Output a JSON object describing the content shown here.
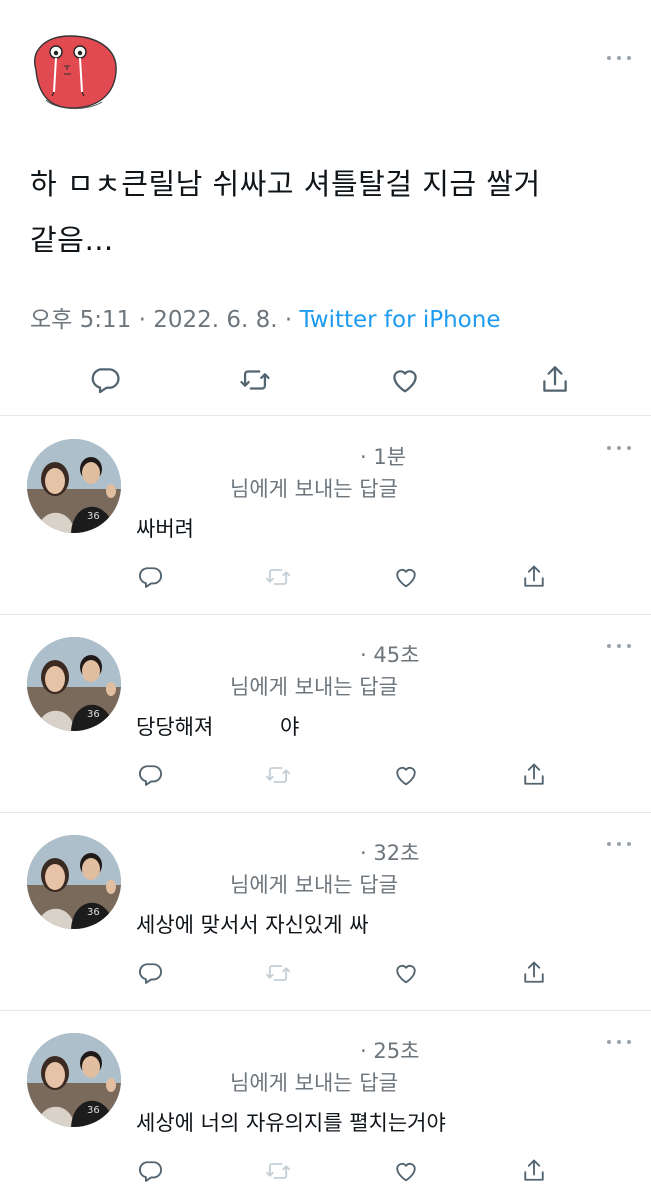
{
  "main_tweet": {
    "text": "하 ㅁㅊ큰릴남 쉬싸고 셔틀탈걸 지금 쌀거\n같음…",
    "time": "오후 5:11",
    "separator": "·",
    "date": "2022. 6. 8.",
    "source": "Twitter for iPhone",
    "actions": [
      "reply-icon",
      "retweet-icon",
      "like-icon",
      "share-icon"
    ]
  },
  "replies": [
    {
      "time": "· 1분",
      "replying_to": "님에게 보내는 답글",
      "text": "싸버려"
    },
    {
      "time": "· 45초",
      "replying_to": "님에게 보내는 답글",
      "text": "당당해져          야"
    },
    {
      "time": "· 32초",
      "replying_to": "님에게 보내는 답글",
      "text": "세상에 맞서서 자신있게 싸"
    },
    {
      "time": "· 25초",
      "replying_to": "님에게 보내는 답글",
      "text": "세상에 너의 자유의지를 펼치는거야"
    }
  ],
  "colors": {
    "text": "#0f1419",
    "secondary": "#6e767d",
    "link": "#1d9bf0",
    "divider": "#e6e9eb",
    "avatar_red": "#e0474f"
  }
}
